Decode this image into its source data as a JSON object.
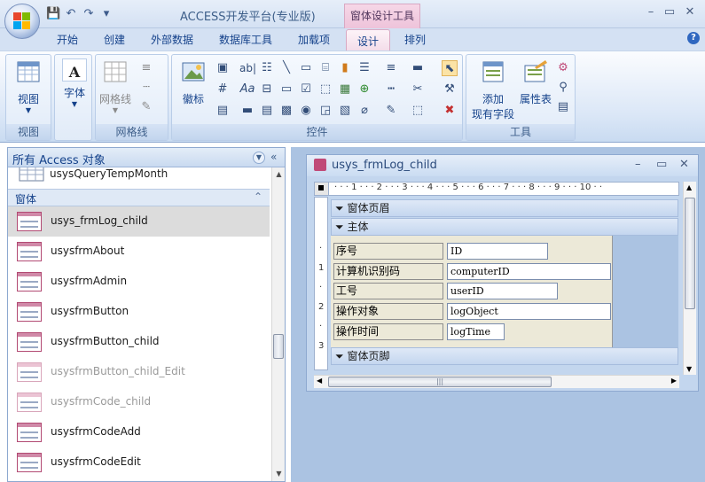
{
  "app": {
    "title": "ACCESS开发平台(专业版)",
    "context_title": "窗体设计工具",
    "minimize": "–",
    "maximize": "▭",
    "close": "✕"
  },
  "qat": {
    "save": "💾",
    "undo": "↶",
    "redo": "↷",
    "more": "▾"
  },
  "tabs": [
    {
      "label": "开始"
    },
    {
      "label": "创建"
    },
    {
      "label": "外部数据"
    },
    {
      "label": "数据库工具"
    },
    {
      "label": "加载项"
    },
    {
      "label": "设计",
      "active": true
    },
    {
      "label": "排列"
    }
  ],
  "ribbon": {
    "groups": {
      "view": {
        "label": "视图",
        "button": "视图"
      },
      "font": {
        "button": "字体"
      },
      "gridlines": {
        "label": "网格线",
        "button": "网格线"
      },
      "controls": {
        "label": "控件",
        "logo_button": "徽标"
      },
      "tools": {
        "label": "工具",
        "add_fields": "添加\n现有字段",
        "add_fields_1": "添加",
        "add_fields_2": "现有字段",
        "property_sheet": "属性表"
      }
    }
  },
  "nav": {
    "title": "所有 Access 对象",
    "top_item": "usysQueryTempMonth",
    "group": "窗体",
    "items": [
      {
        "label": "usys_frmLog_child",
        "selected": true
      },
      {
        "label": "usysfrmAbout"
      },
      {
        "label": "usysfrmAdmin"
      },
      {
        "label": "usysfrmButton"
      },
      {
        "label": "usysfrmButton_child"
      },
      {
        "label": "usysfrmButton_child_Edit",
        "dim": true
      },
      {
        "label": "usysfrmCode_child",
        "dim": true
      },
      {
        "label": "usysfrmCodeAdd"
      },
      {
        "label": "usysfrmCodeEdit"
      }
    ]
  },
  "form_window": {
    "title": "usys_frmLog_child",
    "ruler": "· · · 1 · · · 2 · · · 3 · · · 4 · · · 5 · · · 6 · · · 7 · · · 8 · · · 9 · · · 10 · ·",
    "ruler_v": [
      "·",
      "1",
      "·",
      "2",
      "·",
      "3"
    ],
    "bands": {
      "header": "窗体页眉",
      "detail": "主体",
      "footer": "窗体页脚"
    },
    "fields": [
      {
        "label": "序号",
        "control": "ID"
      },
      {
        "label": "计算机识别码",
        "control": "computerID"
      },
      {
        "label": "工号",
        "control": "userID"
      },
      {
        "label": "操作对象",
        "control": "logObject"
      },
      {
        "label": "操作时间",
        "control": "logTime"
      }
    ]
  }
}
